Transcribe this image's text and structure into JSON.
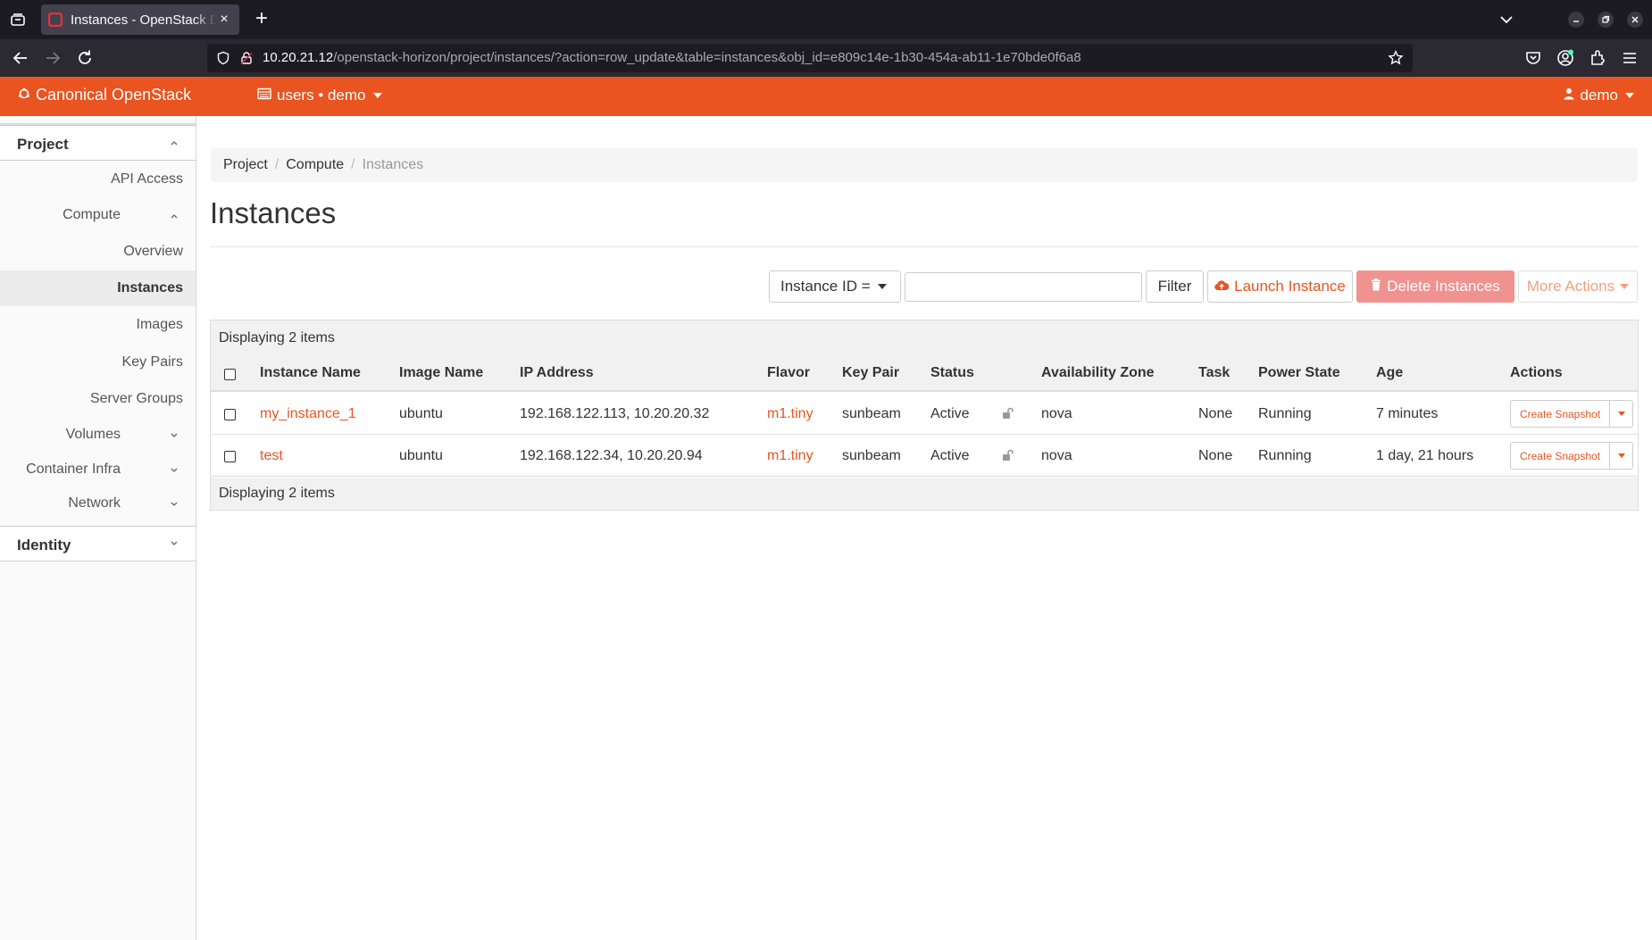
{
  "browser": {
    "tab_title": "Instances - OpenStack Dashboard",
    "new_tab": "+",
    "tab_close": "×",
    "url_host": "10.20.21.12",
    "url_path": "/openstack-horizon/project/instances/?action=row_update&table=instances&obj_id=e809c14e-1b30-454a-ab11-1e70bde0f6a8"
  },
  "header": {
    "brand": "Canonical OpenStack",
    "project_picker": "users • demo",
    "user": "demo",
    "accent_color": "#e95420"
  },
  "sidebar": {
    "project_label": "Project",
    "api_access": "API Access",
    "compute_label": "Compute",
    "overview": "Overview",
    "instances": "Instances",
    "images": "Images",
    "key_pairs": "Key Pairs",
    "server_groups": "Server Groups",
    "volumes": "Volumes",
    "container_infra": "Container Infra",
    "network": "Network",
    "identity_label": "Identity"
  },
  "breadcrumb": {
    "project": "Project",
    "compute": "Compute",
    "current": "Instances",
    "separator": "/"
  },
  "page": {
    "title": "Instances"
  },
  "toolbar": {
    "filter_field": "Instance ID =",
    "filter_value": "",
    "filter_button": "Filter",
    "launch_button": "Launch Instance",
    "delete_button": "Delete Instances",
    "more_actions": "More Actions"
  },
  "table": {
    "caption_top": "Displaying 2 items",
    "caption_bottom": "Displaying 2 items",
    "columns": {
      "name": "Instance Name",
      "image": "Image Name",
      "ip": "IP Address",
      "flavor": "Flavor",
      "key_pair": "Key Pair",
      "status": "Status",
      "zone": "Availability Zone",
      "task": "Task",
      "power": "Power State",
      "age": "Age",
      "actions": "Actions"
    },
    "rows": [
      {
        "name": "my_instance_1",
        "image": "ubuntu",
        "ip": "192.168.122.113, 10.20.20.32",
        "flavor": "m1.tiny",
        "key_pair": "sunbeam",
        "status": "Active",
        "zone": "nova",
        "task": "None",
        "power": "Running",
        "age": "7 minutes",
        "action": "Create Snapshot"
      },
      {
        "name": "test",
        "image": "ubuntu",
        "ip": "192.168.122.34, 10.20.20.94",
        "flavor": "m1.tiny",
        "key_pair": "sunbeam",
        "status": "Active",
        "zone": "nova",
        "task": "None",
        "power": "Running",
        "age": "1 day, 21 hours",
        "action": "Create Snapshot"
      }
    ]
  }
}
